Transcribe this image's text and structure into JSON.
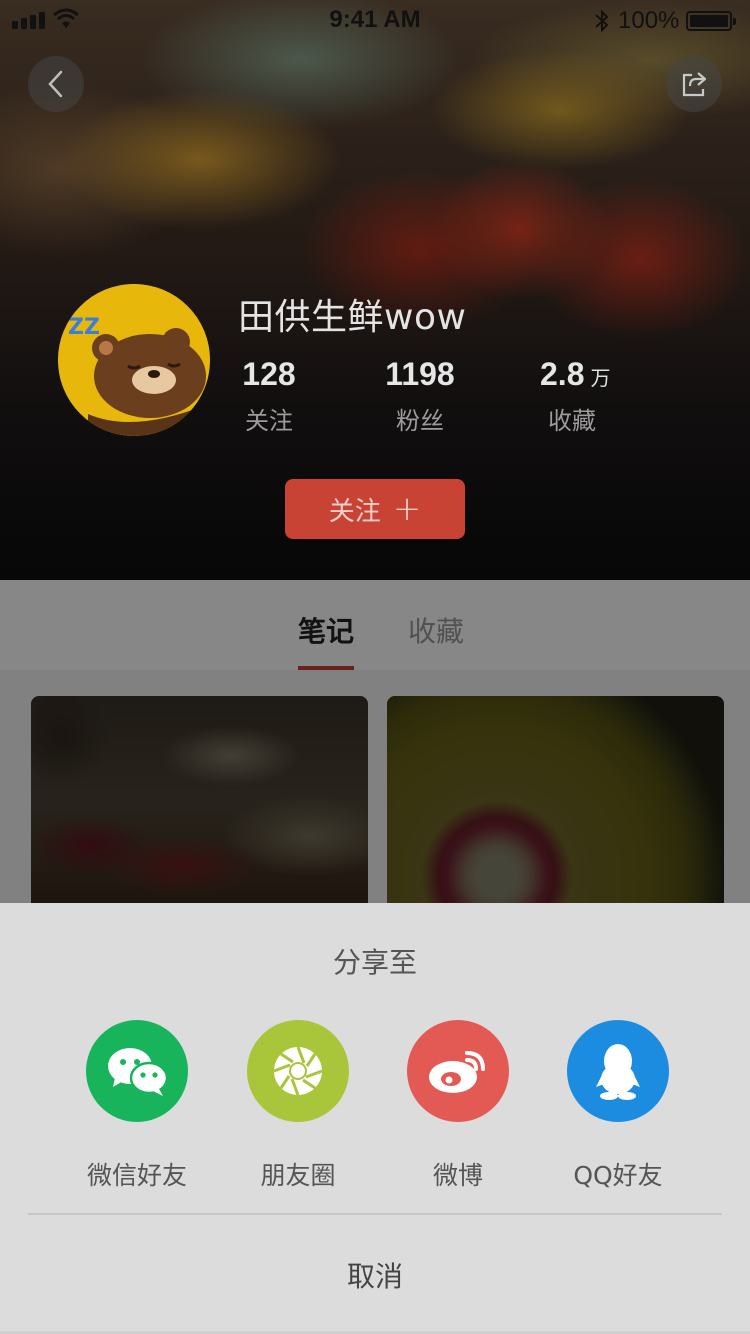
{
  "status_bar": {
    "time": "9:41 AM",
    "battery_percent": "100%",
    "icons": [
      "signal-icon",
      "wifi-icon",
      "bluetooth-icon",
      "battery-icon"
    ]
  },
  "header": {
    "back_icon": "chevron-left-icon",
    "share_icon": "share-icon",
    "avatar": "bear-sleeping-avatar",
    "username": "田供生鲜wow",
    "stats": {
      "following": {
        "value": "128",
        "label": "关注"
      },
      "followers": {
        "value": "1198",
        "label": "粉丝"
      },
      "favorites": {
        "value": "2.8",
        "unit": "万",
        "label": "收藏"
      }
    },
    "follow_button": {
      "label": "关注",
      "icon": "plus-icon"
    }
  },
  "tabs": {
    "items": [
      {
        "label": "笔记",
        "active": true
      },
      {
        "label": "收藏",
        "active": false
      }
    ]
  },
  "grid": {
    "cards": [
      {
        "image": "market-photo"
      },
      {
        "image": "kiwi-photo"
      }
    ]
  },
  "share_sheet": {
    "title": "分享至",
    "options": [
      {
        "label": "微信好友",
        "icon": "wechat-icon",
        "color": "#17b45c"
      },
      {
        "label": "朋友圈",
        "icon": "moments-icon",
        "color": "#a9c53a"
      },
      {
        "label": "微博",
        "icon": "weibo-icon",
        "color": "#e35a55"
      },
      {
        "label": "QQ好友",
        "icon": "qq-icon",
        "color": "#1c8ce0"
      }
    ],
    "cancel": "取消"
  },
  "colors": {
    "accent": "#c94335",
    "sheet_background": "#dcdcdc"
  }
}
